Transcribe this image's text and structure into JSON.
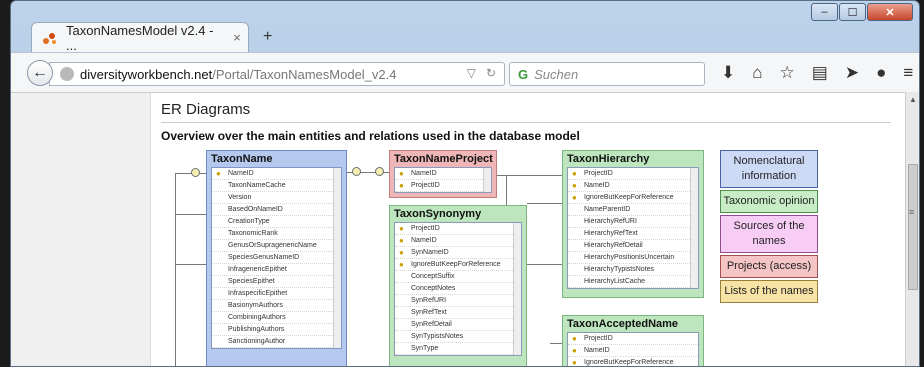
{
  "browser": {
    "tab_title": "TaxonNamesModel v2.4 - ...",
    "tab_close": "×",
    "new_tab": "+",
    "url_host": "diversityworkbench.net",
    "url_path": "/Portal/TaxonNamesModel_v2.4",
    "search_placeholder": "Suchen",
    "window_buttons": [
      "–",
      "☐",
      "✕"
    ]
  },
  "page": {
    "heading": "ER Diagrams",
    "overview": "Overview over the main entities and relations used in the database model"
  },
  "tables": {
    "taxonname": {
      "title": "TaxonName",
      "rows": [
        "NameID",
        "TaxonNameCache",
        "Version",
        "BasedOnNameID",
        "CreationType",
        "TaxonomicRank",
        "GenusOrSupragenericName",
        "SpeciesGenusNameID",
        "InfragenericEpithet",
        "SpeciesEpithet",
        "InfraspecificEpithet",
        "BasionymAuthors",
        "CombiningAuthors",
        "PublishingAuthors",
        "SanctioningAuthor"
      ]
    },
    "taxonnameproject": {
      "title": "TaxonNameProject",
      "rows": [
        "NameID",
        "ProjectID"
      ]
    },
    "taxonsynonymy": {
      "title": "TaxonSynonymy",
      "rows": [
        "ProjectID",
        "NameID",
        "SynNameID",
        "IgnoreButKeepForReference",
        "ConceptSuffix",
        "ConceptNotes",
        "SynRefURI",
        "SynRefText",
        "SynRefDetail",
        "SynTypistsNotes",
        "SynType"
      ]
    },
    "taxonhierarchy": {
      "title": "TaxonHierarchy",
      "rows": [
        "ProjectID",
        "NameID",
        "IgnoreButKeepForReference",
        "NameParentID",
        "HierarchyRefURI",
        "HierarchyRefText",
        "HierarchyRefDetail",
        "HierarchyPositionIsUncertain",
        "HierarchyTypistsNotes",
        "HierarchyListCache"
      ]
    },
    "taxonacceptedname": {
      "title": "TaxonAcceptedName",
      "rows": [
        "ProjectID",
        "NameID",
        "IgnoreButKeepForReference"
      ]
    }
  },
  "legend": [
    "Nomenclatural information",
    "Taxonomic opinion",
    "Sources of the names",
    "Projects (access)",
    "Lists of the names"
  ]
}
